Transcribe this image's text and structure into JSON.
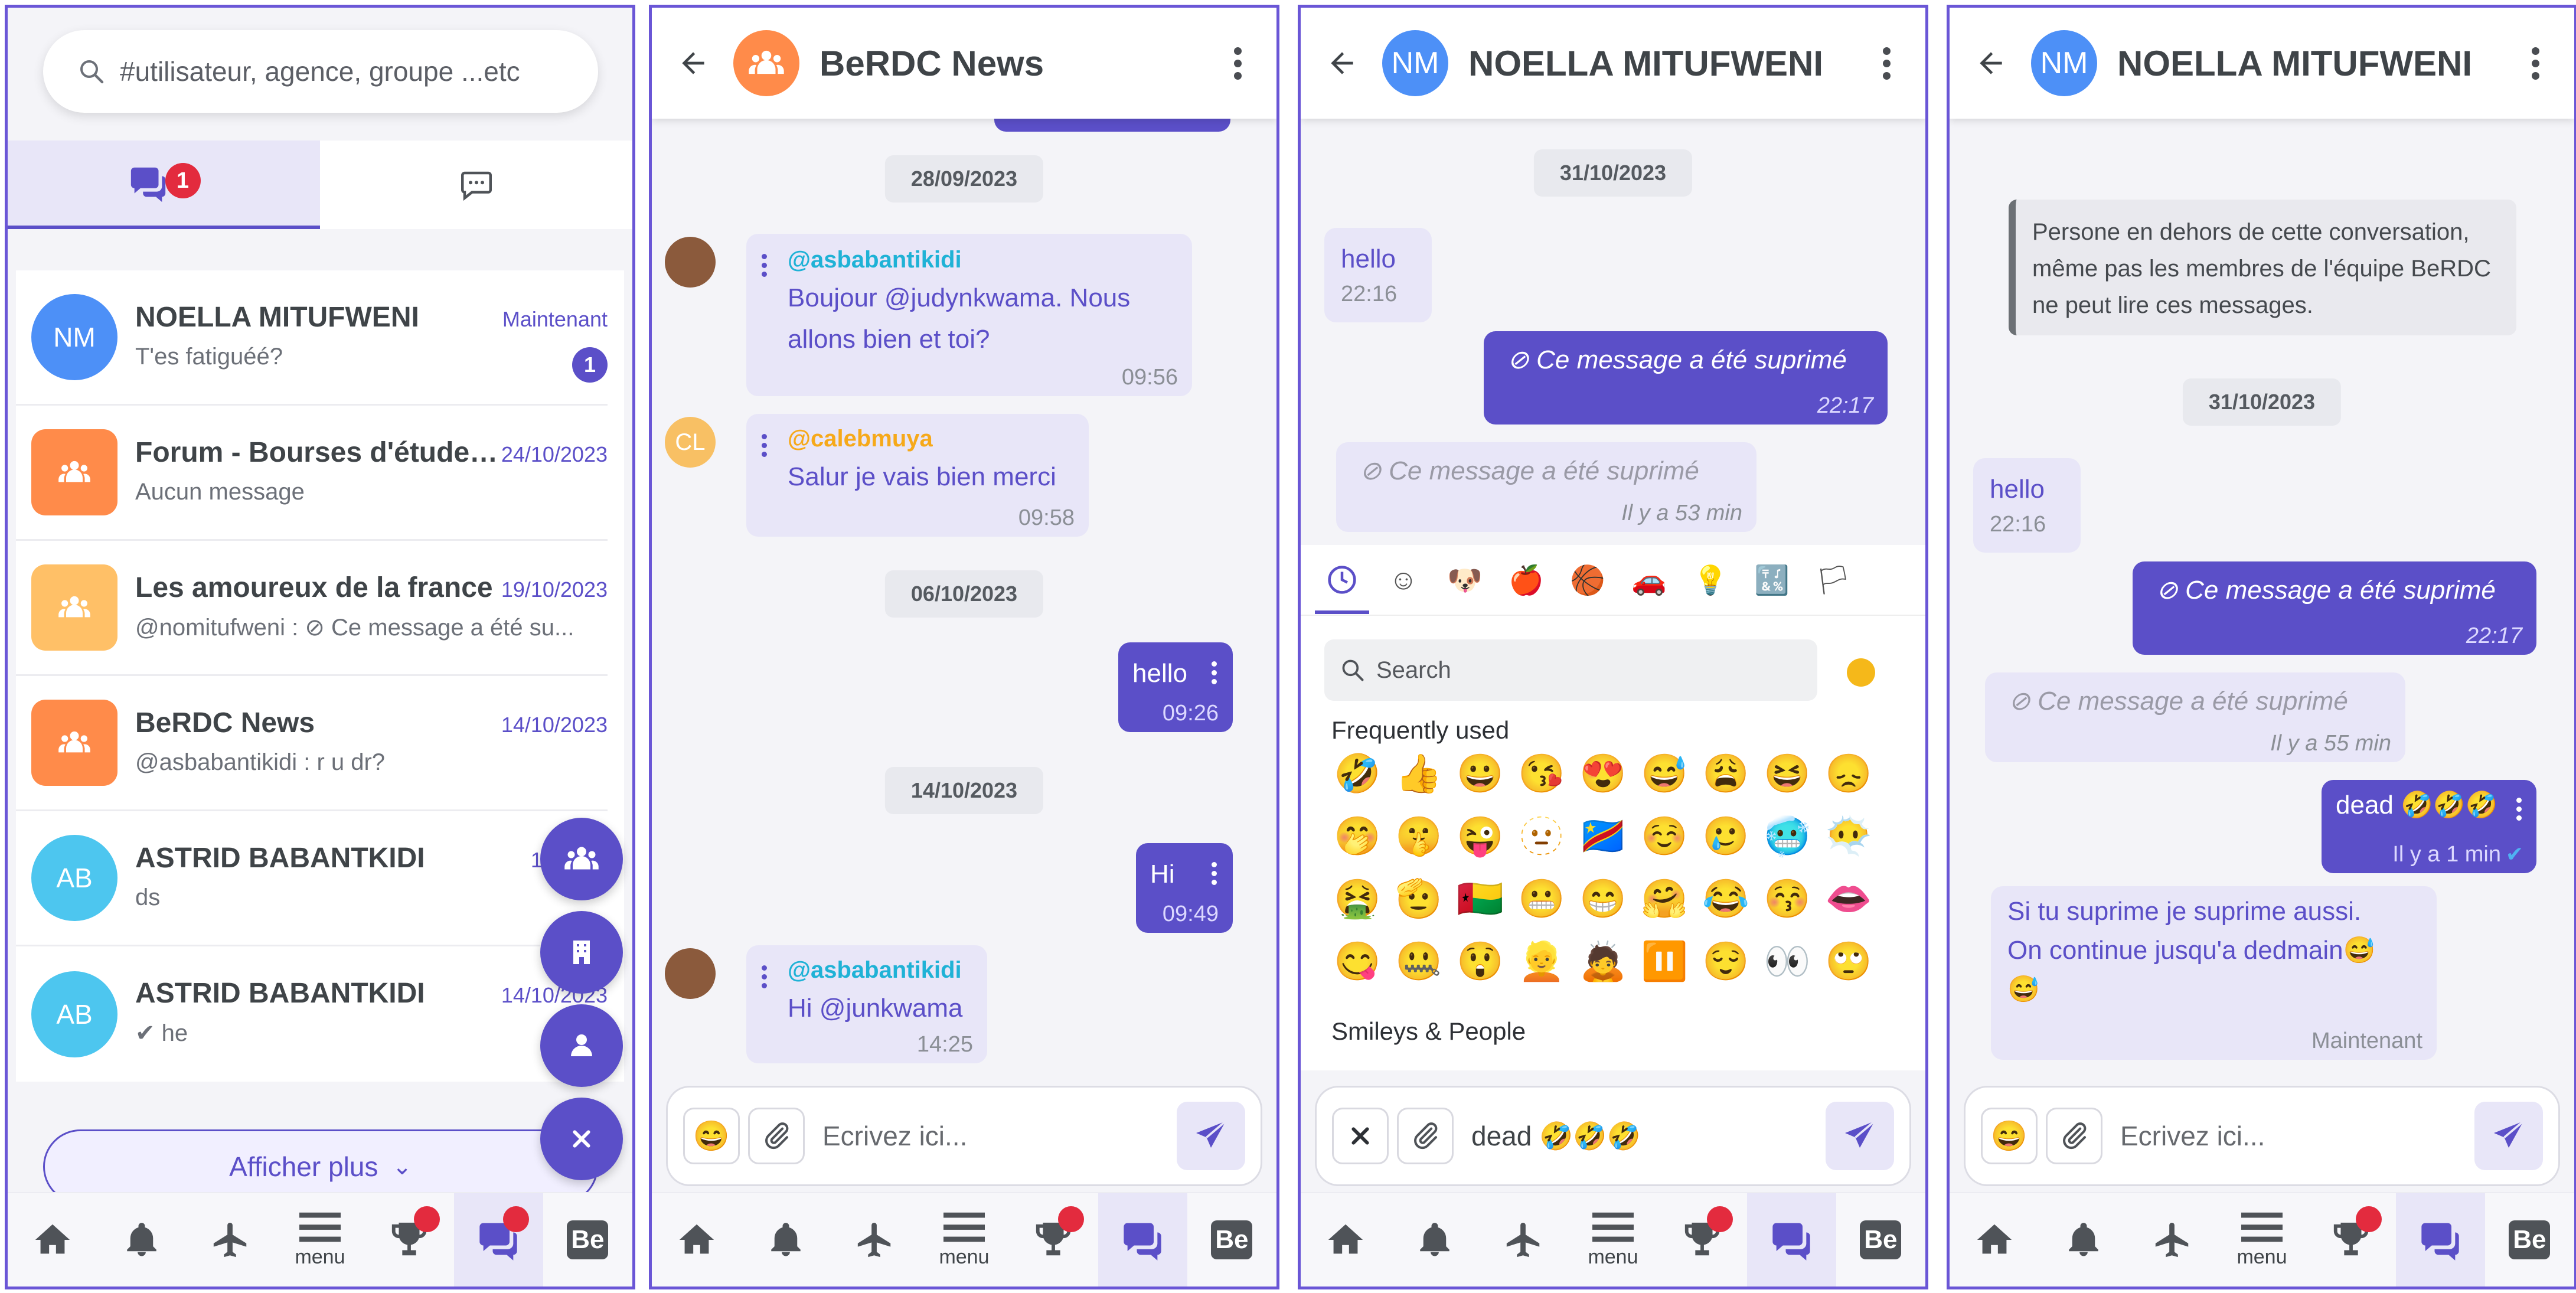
{
  "screen1": {
    "search_placeholder": "#utilisateur, agence, groupe ...etc",
    "tab_badge": "1",
    "conversations": [
      {
        "initials": "NM",
        "name": "NOELLA MITUFWENI",
        "preview": "T'es fatiguéé?",
        "time": "Maintenant",
        "unread": "1",
        "avatar_color": "#4d90f7"
      },
      {
        "initials": "",
        "name": "Forum - Bourses d'études...",
        "preview": "Aucun message",
        "time": "24/10/2023",
        "unread": "",
        "avatar_color": "#ff8b4a"
      },
      {
        "initials": "",
        "name": "Les amoureux de la france",
        "preview": "@nomitufweni :  ⊘ Ce message a été su...",
        "time": "19/10/2023",
        "unread": "",
        "avatar_color": "#ffc067"
      },
      {
        "initials": "",
        "name": "BeRDC News",
        "preview": "@asbabantikidi : r u dr?",
        "time": "14/10/2023",
        "unread": "",
        "avatar_color": "#ff8b4a"
      },
      {
        "initials": "AB",
        "name": "ASTRID BABANTKIDI",
        "preview": "ds",
        "time": "14/1",
        "unread": "",
        "avatar_color": "#4dc6ef"
      },
      {
        "initials": "AB",
        "name": "ASTRID BABANTKIDI",
        "preview": "✔ he",
        "time": "14/10/2023",
        "unread": "",
        "avatar_color": "#4dc6ef"
      }
    ],
    "show_more": "Afficher plus"
  },
  "nav": {
    "menu_label": "menu",
    "be_label": "Be"
  },
  "composer": {
    "placeholder": "Ecrivez ici..."
  },
  "screen2": {
    "title": "BeRDC News",
    "dates": [
      "28/09/2023",
      "06/10/2023",
      "14/10/2023"
    ],
    "messages": [
      {
        "author": "@asbabantikidi",
        "text_line1": "Boujour @judynkwama. Nous",
        "text_line2": "allons bien et toi?",
        "time": "09:56"
      },
      {
        "author": "@calebmuya",
        "initials": "CL",
        "text": "Salur je vais bien merci",
        "time": "09:58"
      },
      {
        "text": "hello",
        "time": "09:26"
      },
      {
        "text": "Hi",
        "time": "09:49"
      },
      {
        "author": "@asbabantikidi",
        "text": "Hi @junkwama",
        "time": "14:25"
      }
    ]
  },
  "screen3": {
    "initials": "NM",
    "title": "NOELLA MITUFWENI",
    "date": "31/10/2023",
    "messages": [
      {
        "text": "hello",
        "time": "22:16"
      },
      {
        "text": "⊘ Ce message a été suprimé",
        "time": "22:17"
      },
      {
        "text": "⊘ Ce message a été suprimé",
        "time": "Il y a 53 min"
      }
    ],
    "emoji_search": "Search",
    "frequently_used": "Frequently used",
    "smileys_people": "Smileys & People",
    "emojis": [
      "🤣",
      "👍",
      "😀",
      "😘",
      "😍",
      "😅",
      "😩",
      "😆",
      "😞",
      "🤭",
      "🤫",
      "😜",
      "🫥",
      "🇨🇩",
      "☺️",
      "🥲",
      "🥶",
      "😶‍🌫️",
      "🤮",
      "🫡",
      "🇬🇼",
      "😬",
      "😁",
      "🤗",
      "😂",
      "😚",
      "👄",
      "😋",
      "🤐",
      "😲",
      "👱",
      "🙇",
      "⏸️",
      "😌",
      "👀",
      "🙄"
    ],
    "input_value": "dead 🤣🤣🤣"
  },
  "screen4": {
    "initials": "NM",
    "title": "NOELLA MITUFWENI",
    "notice": "Persone en dehors de cette conversation, même pas les membres de l'équipe BeRDC ne peut lire ces messages.",
    "date": "31/10/2023",
    "messages": [
      {
        "text": "hello",
        "time": "22:16"
      },
      {
        "text": "⊘ Ce message a été suprimé",
        "time": "22:17"
      },
      {
        "text": "⊘ Ce message a été suprimé",
        "time": "Il y a 55 min"
      },
      {
        "text": "dead 🤣🤣🤣",
        "time": "Il y a 1 min"
      },
      {
        "text_line1": "Si tu suprime je suprime aussi.",
        "text_line2": "On continue jusqu'a dedmain😅",
        "text_line3": "😅",
        "time": "Maintenant"
      }
    ]
  },
  "colors": {
    "accent": "#5b4fc8",
    "badge": "#e32b3e",
    "orange": "#ff8b4a"
  }
}
